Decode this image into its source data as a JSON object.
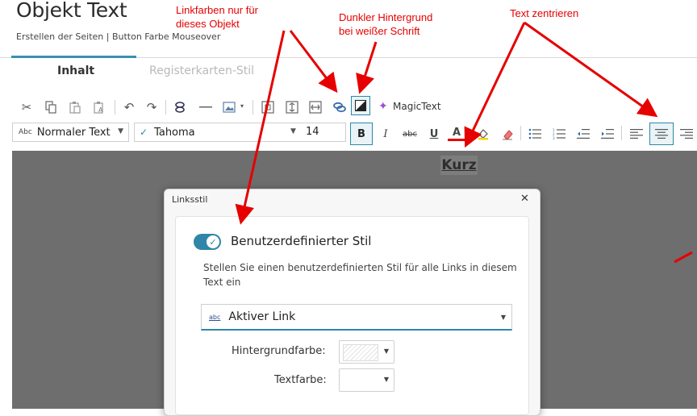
{
  "header": {
    "title": "Objekt Text",
    "subtitle": "Erstellen der Seiten | Button Farbe Mouseover"
  },
  "tabs": [
    {
      "label": "Inhalt",
      "active": true
    },
    {
      "label": "Registerkarten-Stil",
      "active": false
    }
  ],
  "toolbar": {
    "magictext_label": "MagicText",
    "paragraph_style": {
      "prefix": "Abc",
      "value": "Normaler Text"
    },
    "font": {
      "value": "Tahoma"
    },
    "font_size": {
      "value": "14"
    },
    "bold_label": "B",
    "italic_label": "I",
    "strike_label": "abc",
    "underline_label": "U",
    "fontcolor_label": "A"
  },
  "editor": {
    "link_text": "Kurz"
  },
  "dialog": {
    "title": "Linksstil",
    "close_symbol": "✕",
    "toggle_label": "Benutzerdefinierter Stil",
    "toggle_on": true,
    "description_line1": "Stellen Sie einen benutzerdefinierten Stil für alle Links in diesem",
    "description_line2": "Text ein",
    "state_select": {
      "prefix": "abc",
      "value": "Aktiver Link"
    },
    "background_label": "Hintergrundfarbe:",
    "textcolor_label": "Textfarbe:"
  },
  "annotations": [
    {
      "line1": "Linkfarben nur für",
      "line2": "dieses Objekt"
    },
    {
      "line1": "Dunkler Hintergrund",
      "line2": "bei weißer Schrift"
    },
    {
      "line1": "Text zentrieren",
      "line2": ""
    }
  ],
  "colors": {
    "accent": "#3d8fb0",
    "annotation": "#e60000",
    "editor_background": "#6e6e6e"
  }
}
